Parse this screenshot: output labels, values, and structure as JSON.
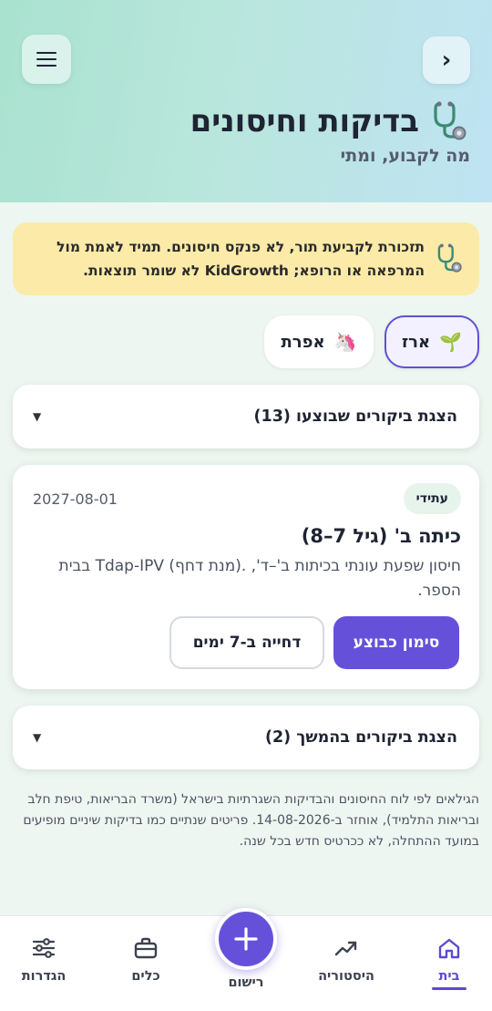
{
  "header": {
    "title": "בדיקות וחיסונים",
    "subtitle": "מה לקבוע, ומתי",
    "title_icon": "stethoscope-icon",
    "menu_icon": "hamburger-menu-icon",
    "back_icon": "chevron-left-icon",
    "back_glyph": "‹"
  },
  "notice": {
    "icon": "stethoscope-icon",
    "text": "תזכורת לקביעת תור, לא פנקס חיסונים. תמיד לאמת מול המרפאה או הרופא; KidGrowth לא שומר תוצאות."
  },
  "kids": [
    {
      "name": "ארז",
      "icon": "seedling-icon",
      "glyph": "🌱",
      "selected": true
    },
    {
      "name": "אפרת",
      "icon": "unicorn-icon",
      "glyph": "🦄",
      "selected": false
    }
  ],
  "done_visits": {
    "label": "הצגת ביקורים שבוצעו (13)",
    "caret": "▼"
  },
  "visit_card": {
    "badge": "עתידי",
    "date": "2027-08-01",
    "title": "כיתה ב' (גיל 7–8)",
    "description": "חיסון שפעת עונתי בכיתות ב'–ד', .(מנת דחף) Tdap-IPV בבית הספר.",
    "mark_done_label": "סימון כבוצע",
    "postpone_label": "דחייה ב-7 ימים"
  },
  "later_visits": {
    "label": "הצגת ביקורים בהמשך (2)",
    "caret": "▼"
  },
  "footnote": "הגילאים לפי לוח החיסונים והבדיקות השגרתיות בישראל (משרד הבריאות, טיפת חלב ובריאות התלמיד), אוחזר ב-14-08-2026. פריטים שנתיים כמו בדיקות שיניים מופיעים במועד ההתחלה, לא ככרטיס חדש בכל שנה.",
  "bottom_nav": {
    "home": "בית",
    "history": "היסטוריה",
    "record": "רישום",
    "tools": "כלים",
    "settings": "הגדרות"
  },
  "colors": {
    "accent": "#6551d9",
    "notice_bg": "#fbeaa8",
    "badge_bg": "#e6f4ec",
    "header_gradient_start": "#a9e2cf",
    "header_gradient_end": "#bfe3f3"
  }
}
